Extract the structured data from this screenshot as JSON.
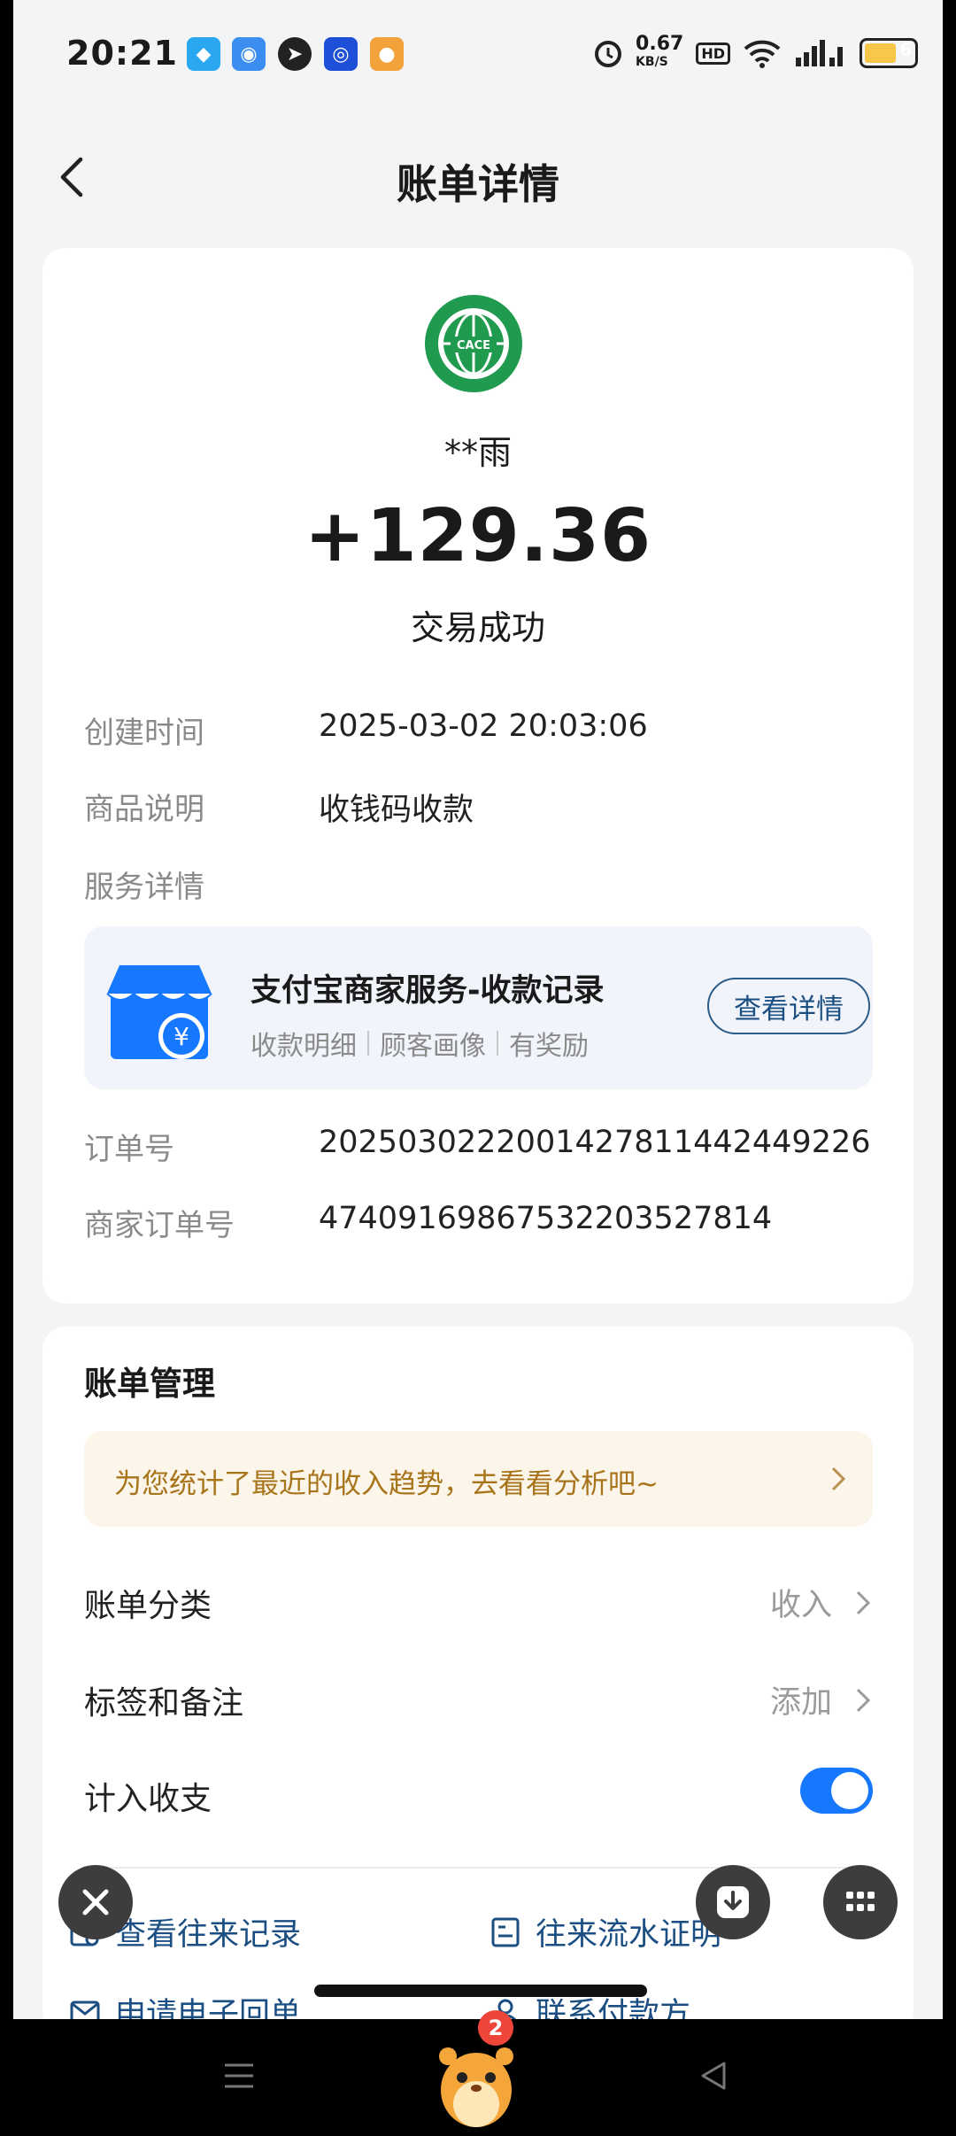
{
  "status_bar": {
    "time": "20:21",
    "network_speed": "0.67",
    "network_unit": "KB/S",
    "hd": "HD",
    "battery": "6"
  },
  "header": {
    "title": "账单详情"
  },
  "transaction": {
    "payer": "**雨",
    "amount": "+129.36",
    "status": "交易成功"
  },
  "details": {
    "created_label": "创建时间",
    "created_value": "2025-03-02 20:03:06",
    "desc_label": "商品说明",
    "desc_value": "收钱码收款",
    "service_label": "服务详情",
    "order_label": "订单号",
    "order_value": "2025030222001427811442449226",
    "merchant_order_label": "商家订单号",
    "merchant_order_value": "474091698675322035278​14"
  },
  "service": {
    "title": "支付宝商家服务-收款记录",
    "tags": [
      "收款明细",
      "顾客画像",
      "有奖励"
    ],
    "button": "查看详情"
  },
  "management": {
    "title": "账单管理",
    "banner": "为您统计了最近的收入趋势，去看看分析吧~",
    "category_label": "账单分类",
    "category_value": "收入",
    "tag_label": "标签和备注",
    "tag_value": "添加",
    "include_label": "计入收支",
    "include_on": true
  },
  "links": {
    "records": "查看往来记录",
    "proof": "往来流水证明",
    "receipt": "申请电子回单",
    "contact": "联系付款方"
  },
  "overlay": {
    "badge_count": "2"
  },
  "colors": {
    "accent": "#1677ff",
    "link": "#1b4e82",
    "banner_text": "#a8741a",
    "logo_green": "#1f9a4e"
  }
}
